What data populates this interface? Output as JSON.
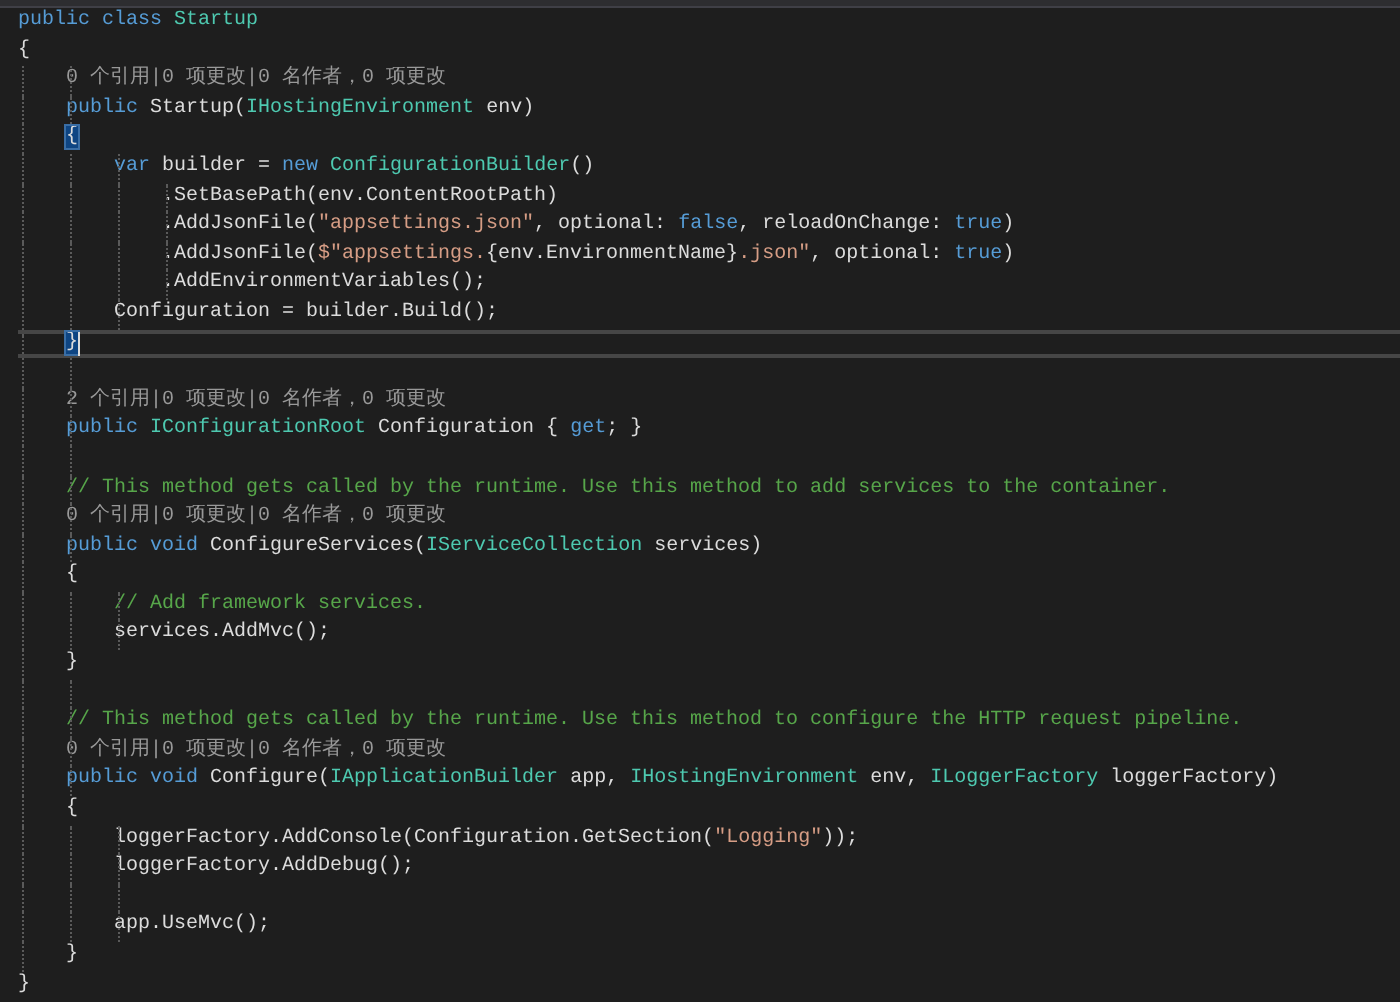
{
  "editor": {
    "lines": [
      {
        "tokens": [
          {
            "text": "public class ",
            "kind": "keyword"
          },
          {
            "text": "Startup",
            "kind": "type"
          }
        ]
      },
      {
        "tokens": [
          {
            "text": "{",
            "kind": "plain"
          }
        ]
      },
      {
        "tokens": [
          {
            "text": "    0 个引用|0 项更改|0 名作者，0 项更改",
            "kind": "lens"
          }
        ]
      },
      {
        "tokens": [
          {
            "text": "    public",
            "kind": "keyword"
          },
          {
            "text": " Startup(",
            "kind": "plain"
          },
          {
            "text": "IHostingEnvironment",
            "kind": "type"
          },
          {
            "text": " env)",
            "kind": "plain"
          }
        ]
      },
      {
        "tokens": [
          {
            "text": "    {",
            "kind": "plain",
            "matched": true
          }
        ]
      },
      {
        "tokens": [
          {
            "text": "        var",
            "kind": "keyword"
          },
          {
            "text": " builder = ",
            "kind": "plain"
          },
          {
            "text": "new ",
            "kind": "keyword"
          },
          {
            "text": "ConfigurationBuilder",
            "kind": "type"
          },
          {
            "text": "()",
            "kind": "plain"
          }
        ]
      },
      {
        "tokens": [
          {
            "text": "            .SetBasePath(env.ContentRootPath)",
            "kind": "plain"
          }
        ]
      },
      {
        "tokens": [
          {
            "text": "            .AddJsonFile(",
            "kind": "plain"
          },
          {
            "text": "\"appsettings.json\"",
            "kind": "string"
          },
          {
            "text": ", optional: ",
            "kind": "plain"
          },
          {
            "text": "false",
            "kind": "keyword"
          },
          {
            "text": ", reloadOnChange: ",
            "kind": "plain"
          },
          {
            "text": "true",
            "kind": "keyword"
          },
          {
            "text": ")",
            "kind": "plain"
          }
        ]
      },
      {
        "tokens": [
          {
            "text": "            .AddJsonFile(",
            "kind": "plain"
          },
          {
            "text": "$\"appsettings.",
            "kind": "string"
          },
          {
            "text": "{env.EnvironmentName}",
            "kind": "plain"
          },
          {
            "text": ".json\"",
            "kind": "string"
          },
          {
            "text": ", optional: ",
            "kind": "plain"
          },
          {
            "text": "true",
            "kind": "keyword"
          },
          {
            "text": ")",
            "kind": "plain"
          }
        ]
      },
      {
        "tokens": [
          {
            "text": "            .AddEnvironmentVariables();",
            "kind": "plain"
          }
        ]
      },
      {
        "tokens": [
          {
            "text": "        Configuration = builder.Build();",
            "kind": "plain"
          }
        ]
      },
      {
        "current": true,
        "tokens": [
          {
            "text": "    }",
            "kind": "plain",
            "matched": true
          }
        ]
      },
      {
        "gap_before": true,
        "tokens": [
          {
            "text": "    2 个引用|0 项更改|0 名作者，0 项更改",
            "kind": "lens"
          }
        ]
      },
      {
        "tokens": [
          {
            "text": "    public ",
            "kind": "keyword"
          },
          {
            "text": "IConfigurationRoot",
            "kind": "type"
          },
          {
            "text": " Configuration { ",
            "kind": "plain"
          },
          {
            "text": "get",
            "kind": "keyword"
          },
          {
            "text": "; }",
            "kind": "plain"
          }
        ]
      },
      {
        "gap_before": true,
        "tokens": [
          {
            "text": "    // This method gets called by the runtime. Use this method to add services to the container.",
            "kind": "comment"
          }
        ]
      },
      {
        "tokens": [
          {
            "text": "    0 个引用|0 项更改|0 名作者，0 项更改",
            "kind": "lens"
          }
        ]
      },
      {
        "tokens": [
          {
            "text": "    public void",
            "kind": "keyword"
          },
          {
            "text": " ConfigureServices(",
            "kind": "plain"
          },
          {
            "text": "IServiceCollection",
            "kind": "type"
          },
          {
            "text": " services)",
            "kind": "plain"
          }
        ]
      },
      {
        "tokens": [
          {
            "text": "    {",
            "kind": "plain"
          }
        ]
      },
      {
        "tokens": [
          {
            "text": "        // Add framework services.",
            "kind": "comment"
          }
        ]
      },
      {
        "tokens": [
          {
            "text": "        services.AddMvc();",
            "kind": "plain"
          }
        ]
      },
      {
        "tokens": [
          {
            "text": "    }",
            "kind": "plain"
          }
        ]
      },
      {
        "gap_before": true,
        "tokens": [
          {
            "text": "    // This method gets called by the runtime. Use this method to configure the HTTP request pipeline.",
            "kind": "comment"
          }
        ]
      },
      {
        "tokens": [
          {
            "text": "    0 个引用|0 项更改|0 名作者，0 项更改",
            "kind": "lens"
          }
        ]
      },
      {
        "tokens": [
          {
            "text": "    public void",
            "kind": "keyword"
          },
          {
            "text": " Configure(",
            "kind": "plain"
          },
          {
            "text": "IApplicationBuilder",
            "kind": "type"
          },
          {
            "text": " app, ",
            "kind": "plain"
          },
          {
            "text": "IHostingEnvironment",
            "kind": "type"
          },
          {
            "text": " env, ",
            "kind": "plain"
          },
          {
            "text": "ILoggerFactory",
            "kind": "type"
          },
          {
            "text": " loggerFactory)",
            "kind": "plain"
          }
        ]
      },
      {
        "tokens": [
          {
            "text": "    {",
            "kind": "plain"
          }
        ]
      },
      {
        "tokens": [
          {
            "text": "        loggerFactory.AddConsole(Configuration.GetSection(",
            "kind": "plain"
          },
          {
            "text": "\"Logging\"",
            "kind": "string"
          },
          {
            "text": "));",
            "kind": "plain"
          }
        ]
      },
      {
        "tokens": [
          {
            "text": "        loggerFactory.AddDebug();",
            "kind": "plain"
          }
        ]
      },
      {
        "gap_before": true,
        "tokens": [
          {
            "text": "        app.UseMvc();",
            "kind": "plain"
          }
        ]
      },
      {
        "tokens": [
          {
            "text": "    }",
            "kind": "plain"
          }
        ]
      },
      {
        "tokens": [
          {
            "text": "}",
            "kind": "plain"
          }
        ]
      }
    ]
  }
}
